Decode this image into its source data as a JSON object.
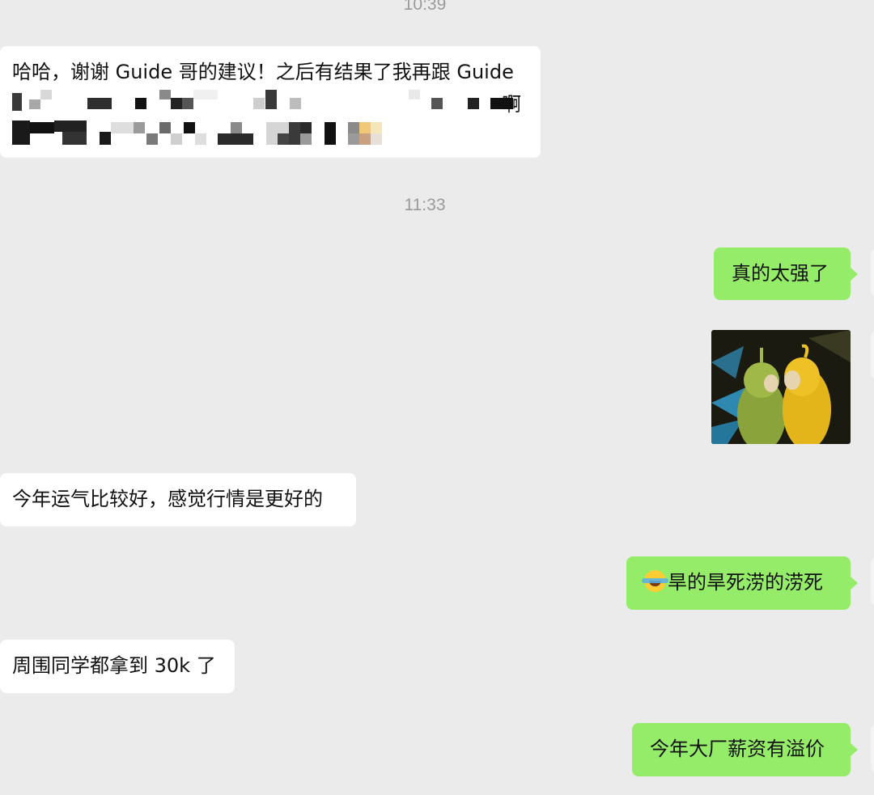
{
  "timestamps": [
    "10:39",
    "11:33"
  ],
  "messages": [
    {
      "side": "received",
      "line1": "哈哈，谢谢 Guide 哥的建议！之后有结果了我再跟 Guide",
      "line2_tail": "啊"
    },
    {
      "side": "sent",
      "text": "真的太强了"
    },
    {
      "side": "sent",
      "type": "sticker",
      "sticker_icon": "teletubbies-sticker"
    },
    {
      "side": "received",
      "text": "今年运气比较好，感觉行情是更好的"
    },
    {
      "side": "sent",
      "emoji_icon": "tears-of-joy-emoji",
      "text": "旱的旱死涝的涝死"
    },
    {
      "side": "received",
      "text": "周围同学都拿到 30k 了"
    },
    {
      "side": "sent",
      "text": "今年大厂薪资有溢价"
    }
  ],
  "colors": {
    "background": "#ebebeb",
    "received_bubble": "#ffffff",
    "sent_bubble": "#95ec69",
    "timestamp": "#9a9a9a"
  }
}
